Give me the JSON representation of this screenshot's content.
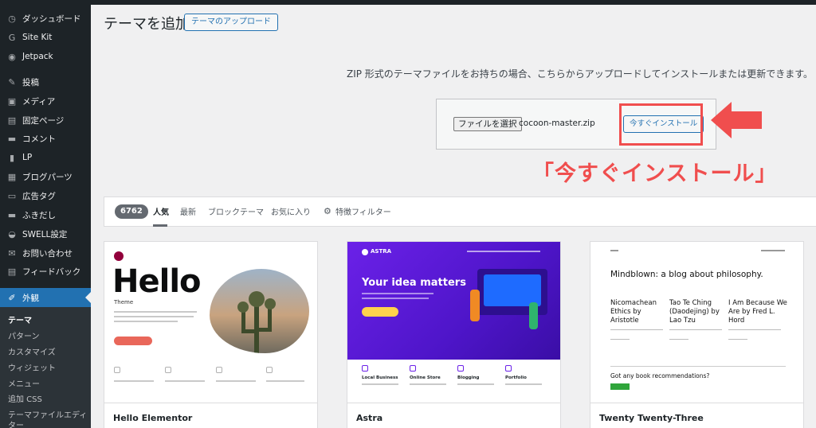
{
  "sidebar": {
    "items": [
      {
        "icon": "dashboard-icon",
        "glyph": "◷",
        "label": "ダッシュボード"
      },
      {
        "icon": "google-icon",
        "glyph": "G",
        "label": "Site Kit"
      },
      {
        "icon": "jetpack-icon",
        "glyph": "◉",
        "label": "Jetpack"
      },
      {
        "icon": "pin-icon",
        "glyph": "✎",
        "label": "投稿"
      },
      {
        "icon": "media-icon",
        "glyph": "▣",
        "label": "メディア"
      },
      {
        "icon": "page-icon",
        "glyph": "▤",
        "label": "固定ページ"
      },
      {
        "icon": "comment-icon",
        "glyph": "▬",
        "label": "コメント"
      },
      {
        "icon": "document-icon",
        "glyph": "▮",
        "label": "LP"
      },
      {
        "icon": "layout-icon",
        "glyph": "▦",
        "label": "ブログパーツ"
      },
      {
        "icon": "ad-icon",
        "glyph": "▭",
        "label": "広告タグ"
      },
      {
        "icon": "speech-bubble-icon",
        "glyph": "▬",
        "label": "ふきだし"
      },
      {
        "icon": "swell-icon",
        "glyph": "◒",
        "label": "SWELL設定"
      },
      {
        "icon": "mail-icon",
        "glyph": "✉",
        "label": "お問い合わせ"
      },
      {
        "icon": "feedback-icon",
        "glyph": "▤",
        "label": "フィードバック"
      },
      {
        "icon": "brush-icon",
        "glyph": "✐",
        "label": "外観"
      }
    ],
    "submenu": [
      "テーマ",
      "パターン",
      "カスタマイズ",
      "ウィジェット",
      "メニュー",
      "追加 CSS",
      "テーマファイルエディ",
      "ター"
    ]
  },
  "header": {
    "title": "テーマを追加",
    "upload_button": "テーマのアップロード"
  },
  "upload": {
    "description": "ZIP 形式のテーマファイルをお持ちの場合、こちらからアップロードしてインストールまたは更新できます。",
    "file_button": "ファイルを選択",
    "file_name": "cocoon-master.zip",
    "install_button": "今すぐインストール"
  },
  "annotation": {
    "text": "「今すぐインストール」",
    "color": "#f04e4e"
  },
  "filter": {
    "count": "6762",
    "tabs": [
      "人気",
      "最新",
      "ブロックテーマ",
      "お気に入り"
    ],
    "feature_filter": "特徴フィルター"
  },
  "themes": [
    {
      "name": "Hello Elementor",
      "preview": {
        "title": "Hello",
        "subtitle": "Theme"
      }
    },
    {
      "name": "Astra",
      "preview": {
        "logo": "ASTRA",
        "headline": "Your idea matters",
        "features": [
          "Local Business",
          "Online Store",
          "Blogging",
          "Portfolio"
        ]
      }
    },
    {
      "name": "Twenty Twenty-Three",
      "preview": {
        "title": "Mindblown: a blog about philosophy.",
        "columns": [
          "Nicomachean Ethics by Aristotle",
          "Tao Te Ching (Daodejing) by Lao Tzu",
          "I Am Because We Are by Fred L. Hord"
        ],
        "cta": "Got any book recommendations?"
      }
    }
  ],
  "colors": {
    "sidebar": "#1d2327",
    "accent": "#2271b1",
    "annotation": "#f04e4e"
  }
}
